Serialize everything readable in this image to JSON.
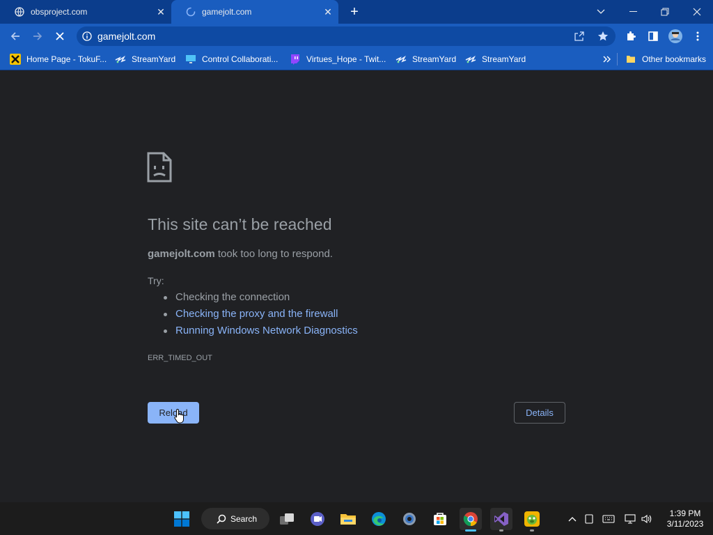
{
  "tabs": [
    {
      "title": "obsproject.com"
    },
    {
      "title": "gamejolt.com"
    }
  ],
  "omnibox": {
    "url": "gamejolt.com"
  },
  "bookmarks": [
    {
      "label": "Home Page - TokuF..."
    },
    {
      "label": "StreamYard"
    },
    {
      "label": "Control Collaborati..."
    },
    {
      "label": "Virtues_Hope - Twit..."
    },
    {
      "label": "StreamYard"
    },
    {
      "label": "StreamYard"
    }
  ],
  "other_bookmarks": "Other bookmarks",
  "error": {
    "title": "This site can’t be reached",
    "host": "gamejolt.com",
    "message": " took too long to respond.",
    "try_label": "Try:",
    "suggestions": [
      {
        "text": "Checking the connection",
        "link": false
      },
      {
        "text": "Checking the proxy and the firewall",
        "link": true
      },
      {
        "text": "Running Windows Network Diagnostics",
        "link": true
      }
    ],
    "code": "ERR_TIMED_OUT",
    "reload_label": "Reload",
    "details_label": "Details"
  },
  "taskbar": {
    "search_label": "Search",
    "time": "1:39 PM",
    "date": "3/11/2023"
  },
  "colors": {
    "tab_strip": "#0b3d8c",
    "toolbar": "#1a5dbf",
    "page_bg": "#202124",
    "text_muted": "#9aa0a6",
    "link": "#8ab4f8"
  }
}
